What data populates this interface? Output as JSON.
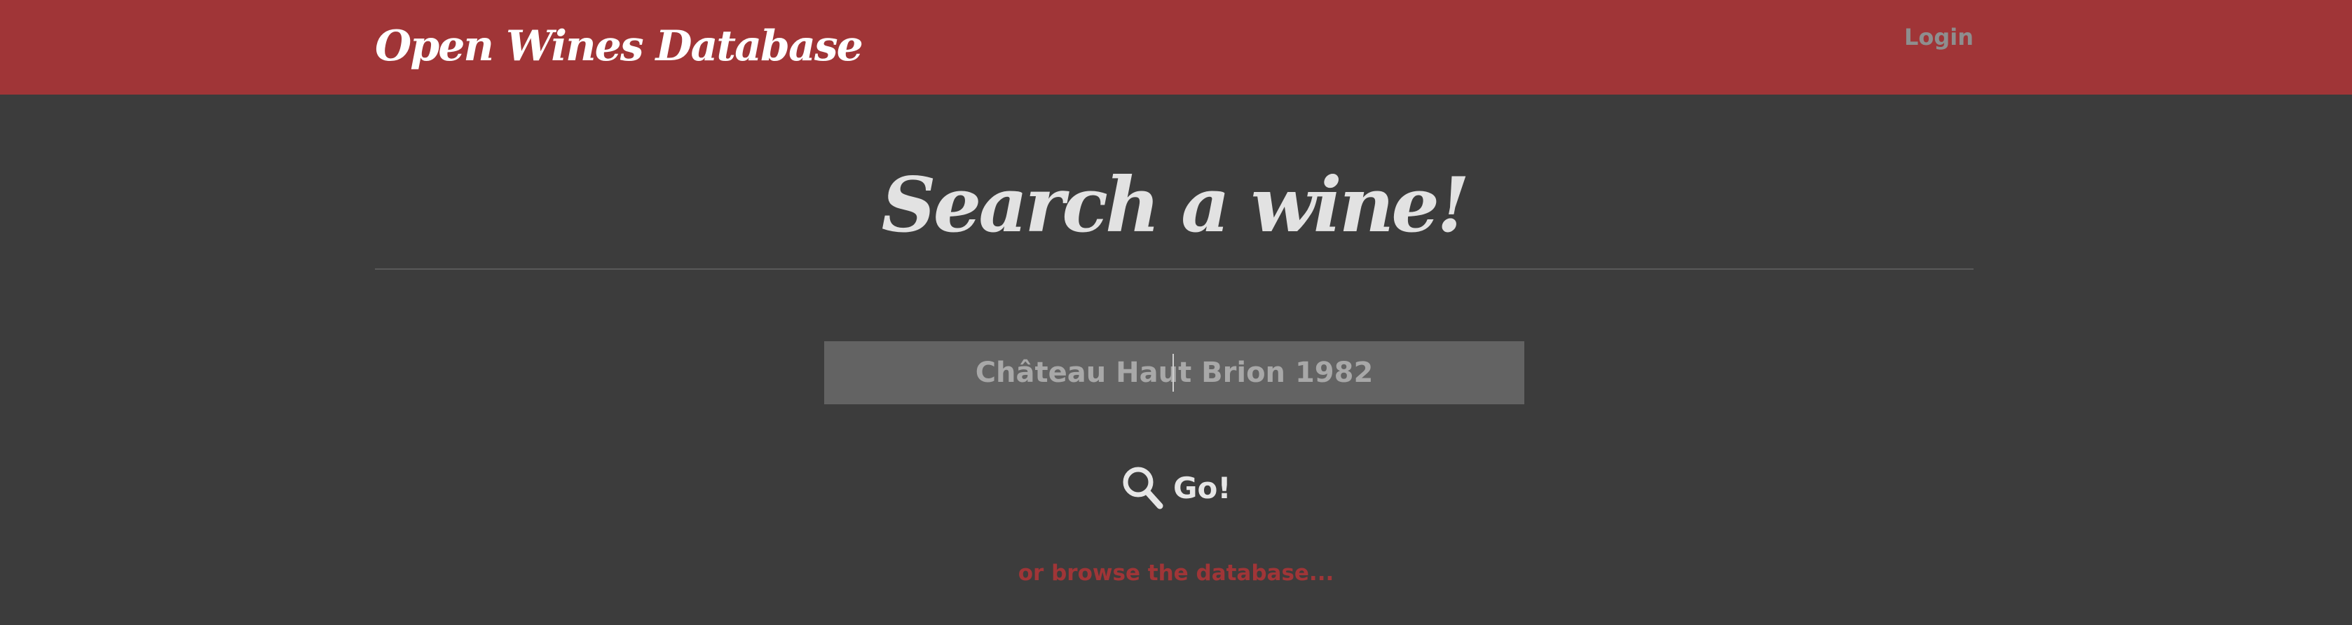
{
  "header": {
    "brand": "Open Wines Database",
    "login_label": "Login"
  },
  "main": {
    "heading": "Search a wine!",
    "search": {
      "value": "Château Haut Brion 1982",
      "placeholder": ""
    },
    "go_label": "Go!",
    "browse_link": "or browse the database..."
  },
  "colors": {
    "brand_red": "#a03537",
    "background": "#3c3c3c",
    "input_bg": "#636363"
  },
  "icons": {
    "go_icon": "search-icon"
  }
}
